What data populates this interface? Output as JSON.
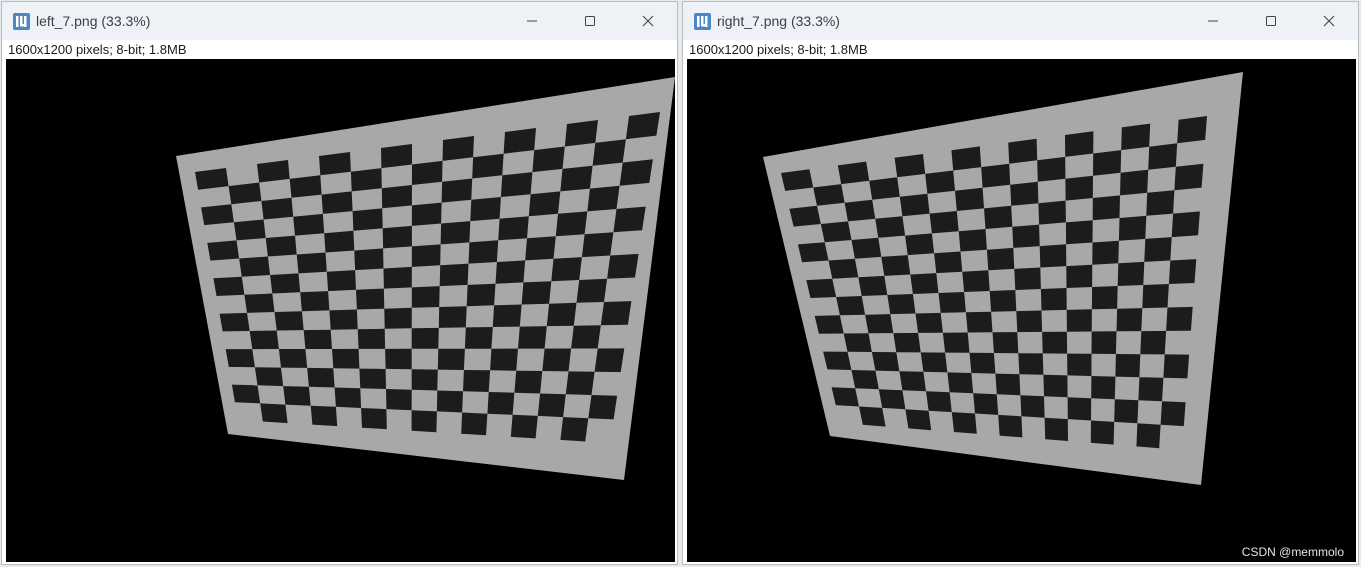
{
  "windows": [
    {
      "id": "left",
      "title": "left_7.png (33.3%)",
      "info": "1600x1200 pixels; 8-bit; 1.8MB",
      "icon": "imagej-icon",
      "controls": {
        "minimize": "minimize-icon",
        "maximize": "maximize-icon",
        "close": "close-icon"
      }
    },
    {
      "id": "right",
      "title": "right_7.png (33.3%)",
      "info": "1600x1200 pixels; 8-bit; 1.8MB",
      "icon": "imagej-icon",
      "controls": {
        "minimize": "minimize-icon",
        "maximize": "maximize-icon",
        "close": "close-icon"
      }
    }
  ],
  "image": {
    "subject": "checkerboard calibration target",
    "board_color": "#a8a8a8",
    "square_color": "#1c1c1c",
    "background_color": "#000000"
  },
  "watermark": "CSDN @memmolo"
}
